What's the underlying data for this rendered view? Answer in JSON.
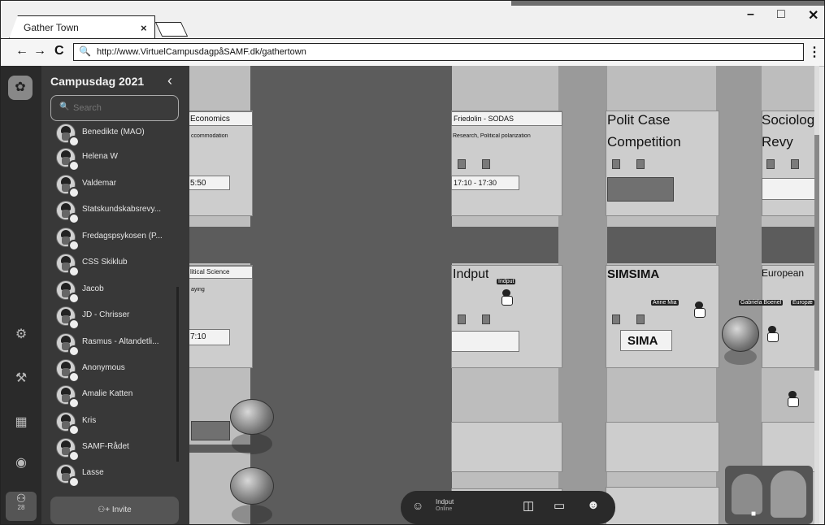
{
  "browser": {
    "tab_title": "Gather Town",
    "tab_close": "×",
    "url": "http://www.VirtuelCampusdagpåSAMF.dk/gathertown",
    "back": "←",
    "forward": "→",
    "reload": "C",
    "menu": "⋮",
    "minimize": "–",
    "maximize": "□",
    "close": "✕"
  },
  "rail": {
    "participants_count": "28",
    "icons": [
      "gear-icon",
      "hammer-icon",
      "calendar-icon",
      "chat-icon",
      "people-icon"
    ]
  },
  "panel": {
    "title": "Campusdag 2021",
    "search_placeholder": "Search",
    "members": [
      "Benedikte (MAO)",
      "Helena W",
      "Valdemar",
      "Statskundskabsrevy...",
      "Fredagspsykosen (P...",
      "CSS Skiklub",
      "Jacob",
      "JD - Chrisser",
      "Rasmus - Altandetli...",
      "Anonymous",
      "Amalie Katten",
      "Kris",
      "SAMF-Rådet",
      "Lasse"
    ],
    "invite_label": "Invite"
  },
  "map": {
    "booths": {
      "b1_title": "Economics",
      "b1_sub": "ccommodation",
      "b1_time": "5:50",
      "b2_title": "Friedolin - SODAS",
      "b2_sub": "Research, Political polarization",
      "b2_time": "17:10 - 17:30",
      "b3_title": "Polit Case",
      "b3_title2": "Competition",
      "b4_title": "Sociolog",
      "b4_title2": "Revy",
      "b5_title": "litical Science",
      "b5_sub": "aying",
      "b5_time": "7:10",
      "b6_title": "Indput",
      "b7_title": "SIMSIMA",
      "b7_sign": "SIMA",
      "b8_title": "European"
    },
    "player_tag": "Indput",
    "other_tags": [
      "Anne Mia",
      "Gabriela Boenel",
      "Europæ"
    ]
  },
  "bottombar": {
    "name": "Indput",
    "status": "Online"
  }
}
